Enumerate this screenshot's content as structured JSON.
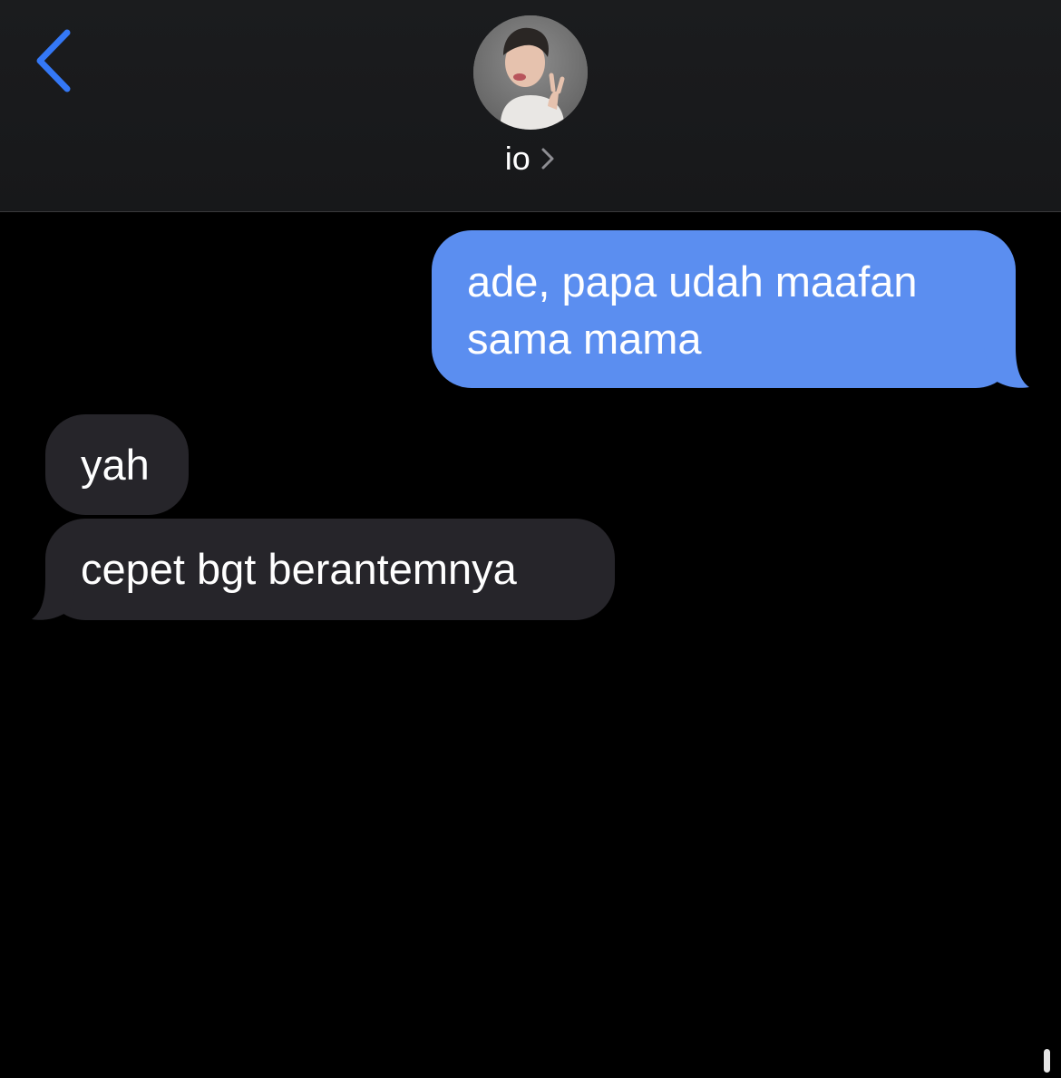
{
  "header": {
    "contact_name": "io",
    "back_icon": "chevron-left-icon",
    "detail_icon": "chevron-right-icon"
  },
  "messages": [
    {
      "direction": "outgoing",
      "text": "ade, papa udah maafan sama mama"
    },
    {
      "direction": "incoming",
      "text": "yah"
    },
    {
      "direction": "incoming",
      "text": "cepet bgt berantemnya"
    }
  ],
  "colors": {
    "accent": "#3478f6",
    "outgoing_bubble": "#5b8ef0",
    "incoming_bubble": "#26252a",
    "background": "#000000",
    "header_background": "#1b1c1e"
  }
}
